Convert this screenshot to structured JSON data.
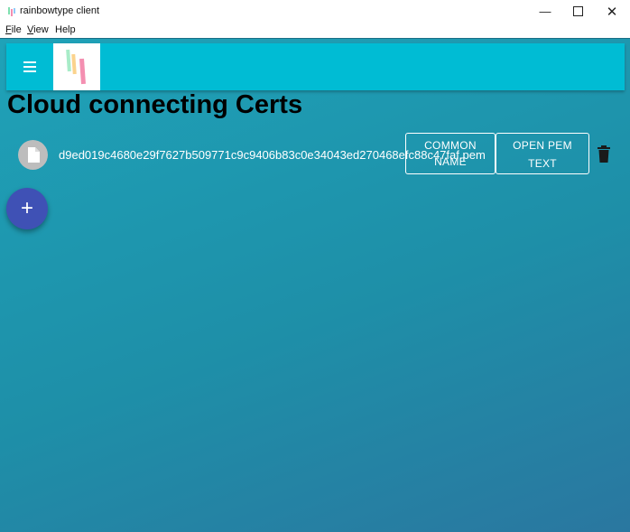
{
  "window": {
    "title": "rainbowtype client",
    "minimize_icon": "minimize-icon",
    "maximize_icon": "maximize-icon",
    "close_icon": "close-icon"
  },
  "menubar": {
    "items": [
      {
        "label": "File",
        "mnemonic": "F",
        "rest": "ile"
      },
      {
        "label": "View",
        "mnemonic": "V",
        "rest": "iew"
      },
      {
        "label": "Help",
        "mnemonic": "",
        "rest": "Help"
      }
    ]
  },
  "appbar": {
    "menu_icon": "hamburger-menu-icon",
    "logo": "rainbowtype-logo",
    "color": "#00bcd4"
  },
  "page": {
    "title": "Cloud connecting Certs"
  },
  "certs": [
    {
      "icon": "file-icon",
      "name": "d9ed019c4680e29f7627b509771c9c9406b83c0e34043ed270468efc88c47faf.pem",
      "common_name_label_line1": "COMMON",
      "common_name_label_line2": "NAME",
      "open_pem_label_line1": "OPEN PEM",
      "open_pem_label_line2": "TEXT",
      "delete_icon": "trash-icon"
    }
  ],
  "fab": {
    "icon": "plus-icon",
    "glyph": "+",
    "color": "#3f51b5"
  }
}
